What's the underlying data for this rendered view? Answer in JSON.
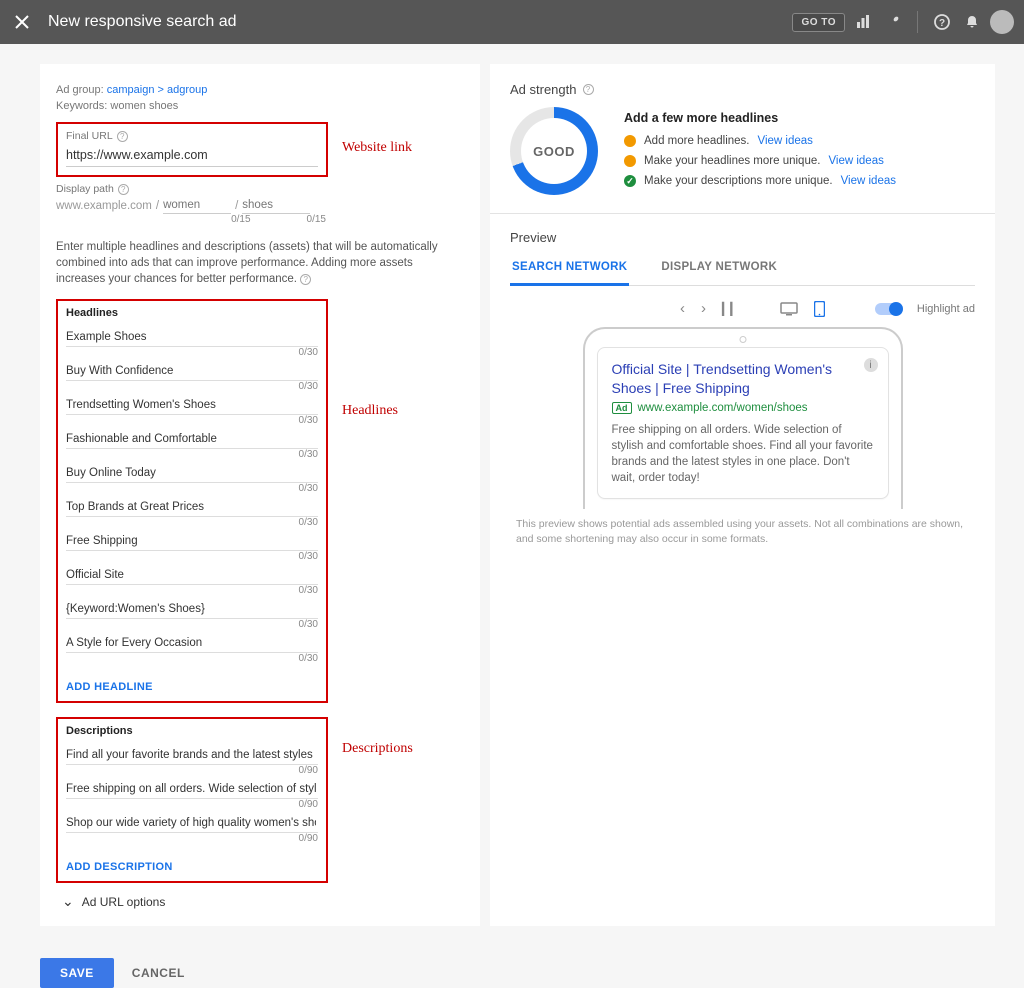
{
  "topbar": {
    "title": "New responsive search ad",
    "goto": "GO TO"
  },
  "meta": {
    "adgroup_label": "Ad group:",
    "campaign": "campaign",
    "gt": ">",
    "adgroup": "adgroup",
    "keywords_label": "Keywords:",
    "keywords": "women shoes"
  },
  "final_url": {
    "label": "Final URL",
    "value": "https://www.example.com",
    "callout": "Website link"
  },
  "display_path": {
    "label": "Display path",
    "domain": "www.example.com",
    "seg1": "women",
    "seg2": "shoes",
    "counter": "0/15"
  },
  "helper": "Enter multiple headlines and descriptions (assets)  that will be automatically combined into ads that can improve performance. Adding more assets increases your chances for better performance.",
  "headlines": {
    "title": "Headlines",
    "callout": "Headlines",
    "counter": "0/30",
    "add": "ADD HEADLINE",
    "items": [
      "Example Shoes",
      "Buy With Confidence",
      "Trendsetting Women's Shoes",
      "Fashionable and Comfortable",
      "Buy Online Today",
      "Top Brands at Great Prices",
      "Free Shipping",
      "Official Site",
      "{Keyword:Women's Shoes}",
      "A Style for Every Occasion"
    ]
  },
  "descriptions": {
    "title": "Descriptions",
    "callout": "Descriptions",
    "counter": "0/90",
    "add": "ADD DESCRIPTION",
    "items": [
      "Find all your favorite brands and the latest styles in one plac",
      "Free shipping on all orders. Wide selection of stylish and co",
      "Shop our wide variety of high quality women's shoes at price"
    ]
  },
  "url_options": "Ad URL options",
  "buttons": {
    "save": "SAVE",
    "cancel": "CANCEL"
  },
  "strength": {
    "title": "Ad strength",
    "gauge": "GOOD",
    "heading": "Add a few more headlines",
    "s1": "Add more headlines.",
    "s2": "Make your headlines more unique.",
    "s3": "Make your descriptions more unique.",
    "view": "View ideas"
  },
  "preview": {
    "title": "Preview",
    "tab1": "SEARCH NETWORK",
    "tab2": "DISPLAY NETWORK",
    "highlight": "Highlight ad",
    "ad_headline": "Official Site | Trendsetting Women's Shoes | Free Shipping",
    "ad_badge": "Ad",
    "ad_url": "www.example.com/women/shoes",
    "ad_desc": "Free shipping on all orders. Wide selection of stylish and comfortable shoes. Find all your favorite brands and the latest styles in one place. Don't wait, order today!",
    "note": "This preview shows potential ads assembled using your assets. Not all combinations are shown, and some shortening may also occur in some formats."
  }
}
